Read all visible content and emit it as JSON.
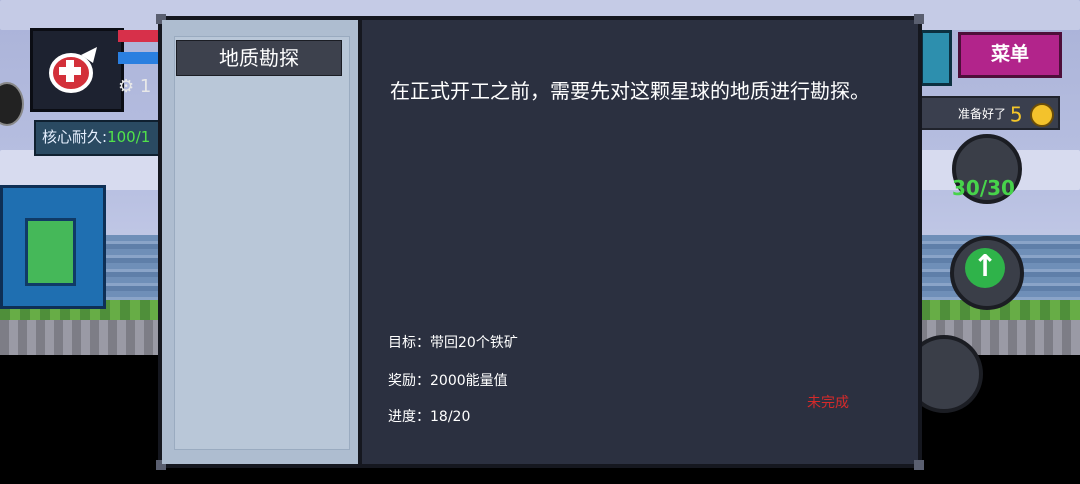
{
  "hud": {
    "core_label": "核心耐久:",
    "core_value": "100/1",
    "stat_value": "1",
    "menu_label": "菜单",
    "ready_label": "准备好了",
    "ready_count": "5",
    "ammo": "30/30"
  },
  "quest": {
    "title": "地质勘探",
    "description": "在正式开工之前，需要先对这颗星球的地质进行勘探。",
    "goal": "目标：带回20个铁矿",
    "reward": "奖励：2000能量值",
    "progress": "进度：18/20",
    "status": "未完成"
  },
  "colors": {
    "panel_bg": "#2b3040",
    "sidebar_bg": "#aebdd0",
    "status_red": "#d52a2a",
    "menu_magenta": "#b2248b"
  }
}
